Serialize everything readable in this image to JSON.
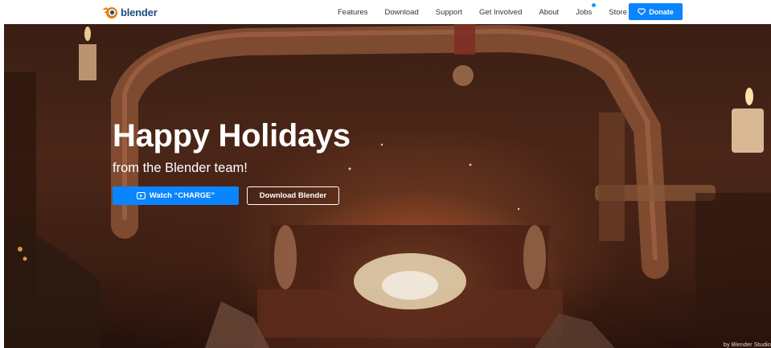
{
  "brand": {
    "logo_text": "blender",
    "logo_icon": "blender-logo-icon",
    "colors": {
      "orange": "#e87d0d",
      "navy": "#1f4d80",
      "accent": "#0a84ff"
    }
  },
  "nav": {
    "items": [
      {
        "label": "Features"
      },
      {
        "label": "Download"
      },
      {
        "label": "Support"
      },
      {
        "label": "Get Involved"
      },
      {
        "label": "About"
      },
      {
        "label": "Jobs",
        "has_notification": true
      },
      {
        "label": "Store"
      }
    ],
    "donate": {
      "label": "Donate",
      "icon": "heart-icon"
    }
  },
  "hero": {
    "title": "Happy Holidays",
    "subtitle": "from the Blender team!",
    "primary_button": {
      "label": "Watch “CHARGE”",
      "icon": "video-play-icon"
    },
    "secondary_button": {
      "label": "Download Blender"
    },
    "credit": "by Blender Studio"
  }
}
